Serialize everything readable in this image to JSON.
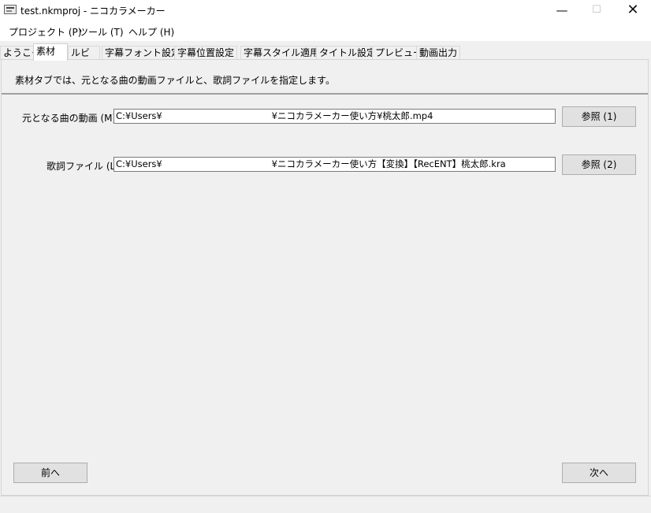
{
  "window": {
    "title": "test.nkmproj - ニコカラメーカー",
    "minimize_glyph": "—",
    "maximize_glyph": "☐",
    "close_glyph": "✕"
  },
  "menu": [
    "プロジェクト (P)",
    "ツール (T)",
    "ヘルプ (H)"
  ],
  "tabs": [
    "ようこそ",
    "素材",
    "ルビ",
    "字幕フォント設定",
    "字幕位置設定",
    "字幕スタイル適用",
    "タイトル設定",
    "プレビュー",
    "動画出力"
  ],
  "active_tab": "素材",
  "description": "素材タブでは、元となる曲の動画ファイルと、歌詞ファイルを指定します。",
  "fields": {
    "movie": {
      "label": "元となる曲の動画 (M):",
      "value": "C:¥Users¥                                      ¥ニコカラメーカー使い方¥桃太郎.mp4",
      "button": "参照 (1)"
    },
    "lyrics": {
      "label": "歌詞ファイル (L):",
      "value": "C:¥Users¥                                      ¥ニコカラメーカー使い方【変換】【RecENT】桃太郎.kra",
      "button": "参照 (2)"
    }
  },
  "nav": {
    "prev": "前へ",
    "next": "次へ"
  },
  "icons": {
    "app": "app-window-icon"
  }
}
